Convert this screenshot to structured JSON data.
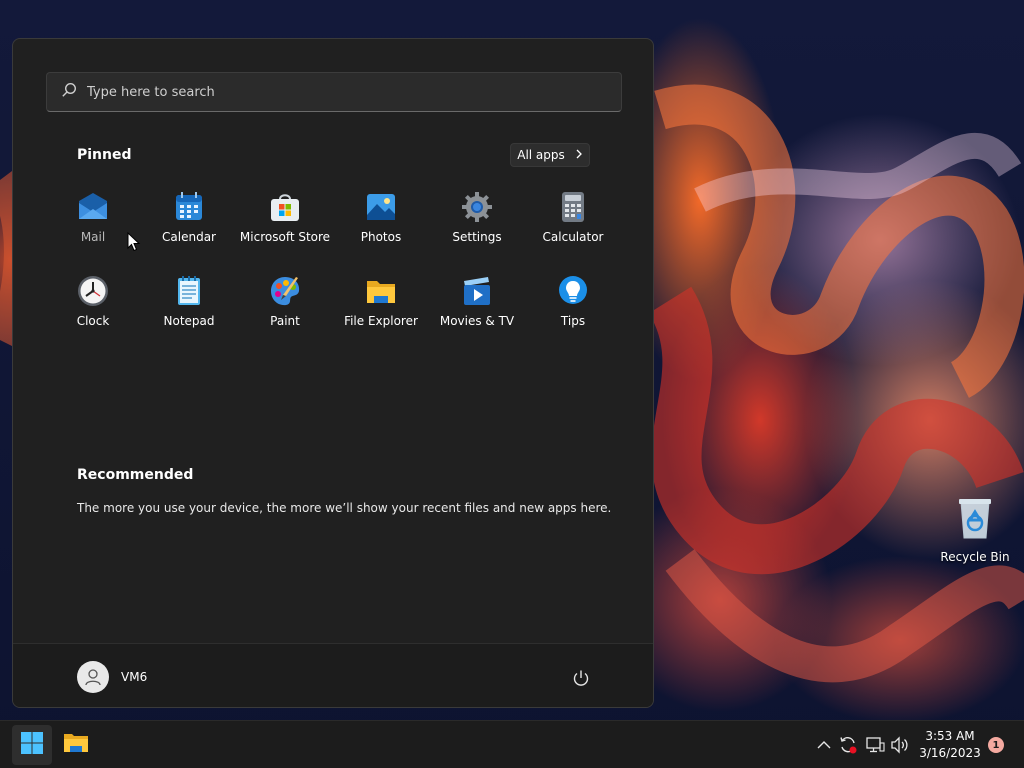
{
  "search": {
    "placeholder": "Type here to search"
  },
  "pinned": {
    "title": "Pinned",
    "all_apps_label": "All apps",
    "apps": [
      {
        "name": "Mail",
        "icon": "mail-icon"
      },
      {
        "name": "Calendar",
        "icon": "calendar-icon"
      },
      {
        "name": "Microsoft Store",
        "icon": "store-icon"
      },
      {
        "name": "Photos",
        "icon": "photos-icon"
      },
      {
        "name": "Settings",
        "icon": "gear-icon"
      },
      {
        "name": "Calculator",
        "icon": "calculator-icon"
      },
      {
        "name": "Clock",
        "icon": "clock-icon"
      },
      {
        "name": "Notepad",
        "icon": "notepad-icon"
      },
      {
        "name": "Paint",
        "icon": "paint-icon"
      },
      {
        "name": "File Explorer",
        "icon": "folder-icon"
      },
      {
        "name": "Movies & TV",
        "icon": "movies-icon"
      },
      {
        "name": "Tips",
        "icon": "tips-icon"
      }
    ]
  },
  "recommended": {
    "title": "Recommended",
    "text": "The more you use your device, the more we’ll show your recent files and new apps here."
  },
  "user": {
    "name": "VM6"
  },
  "desktop": {
    "recycle_bin_label": "Recycle Bin"
  },
  "taskbar": {
    "time": "3:53 AM",
    "date": "3/16/2023",
    "notification_count": "1"
  },
  "colors": {
    "accent": "#0078d4",
    "menu_bg": "#202020",
    "taskbar_bg": "#1c1c1c"
  }
}
